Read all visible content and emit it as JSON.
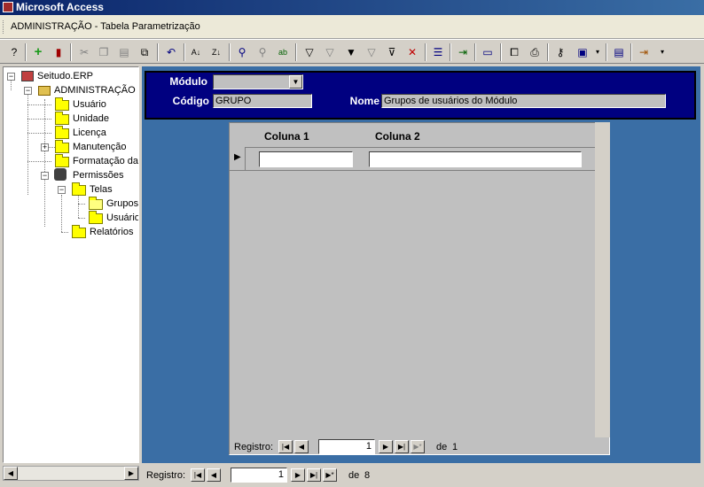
{
  "app": {
    "title": "Microsoft Access"
  },
  "window": {
    "subtitle": "ADMINISTRAÇÃO - Tabela Parametrização"
  },
  "toolbar": {
    "icons": [
      "help-icon",
      "new-record-icon",
      "delete-record-icon",
      "cut-icon",
      "copy-icon",
      "paste-icon",
      "format-painter-icon",
      "undo-icon",
      "sort-ascending-icon",
      "sort-descending-icon",
      "find-icon",
      "find-next-icon",
      "replace-icon",
      "filter-by-selection-icon",
      "filter-by-form-icon",
      "apply-filter-icon",
      "advanced-filter-icon",
      "remove-filter-icon",
      "properties-icon",
      "new-object-icon",
      "form-view-icon",
      "database-window-icon",
      "print-icon",
      "key-icon",
      "office-links-icon",
      "save-icon",
      "exit-icon"
    ]
  },
  "tree": {
    "root": "Seitudo.ERP",
    "admin": "ADMINISTRAÇÃO",
    "items": {
      "usuario": "Usuário",
      "unidade": "Unidade",
      "licenca": "Licença",
      "manutencao": "Manutenção",
      "formatacao": "Formatação da",
      "permissoes": "Permissões",
      "telas": "Telas",
      "grupos": "Grupos",
      "usuarios": "Usuário",
      "relatorios": "Relatórios"
    }
  },
  "form": {
    "modulo_label": "Módulo",
    "modulo_value": "",
    "codigo_label": "Código",
    "codigo_value": "GRUPO",
    "nome_label": "Nome",
    "nome_value": "Grupos de usuários do Módulo"
  },
  "subform": {
    "col1": "Coluna 1",
    "col2": "Coluna 2",
    "nav": {
      "label": "Registro:",
      "current": "1",
      "of": "de",
      "total": "1"
    }
  },
  "mainnav": {
    "label": "Registro:",
    "current": "1",
    "of": "de",
    "total": "8"
  }
}
